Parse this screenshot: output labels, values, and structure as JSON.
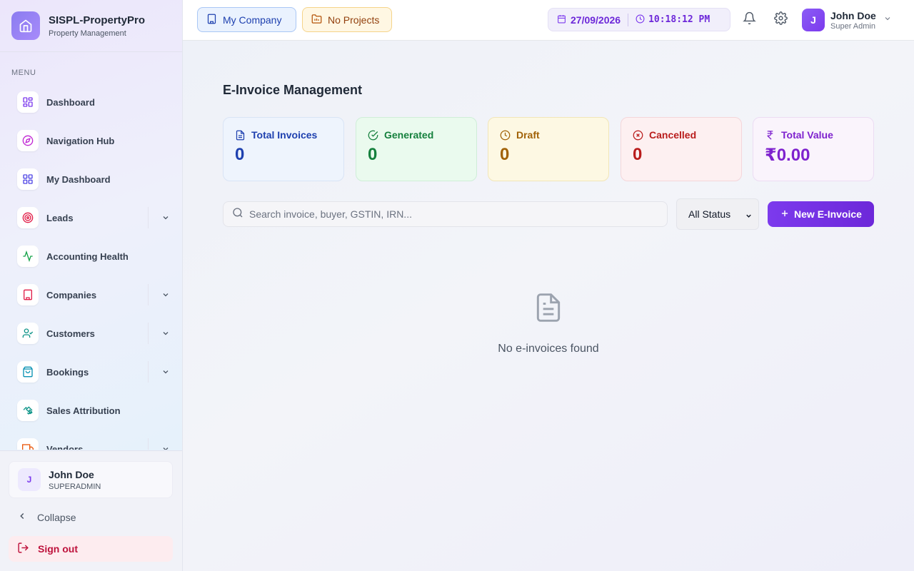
{
  "brand": {
    "name": "SISPL-PropertyPro",
    "subtitle": "Property Management",
    "icon": "home-icon"
  },
  "sidebar": {
    "menu_label": "MENU",
    "items": [
      {
        "label": "Dashboard",
        "icon": "grid-icon",
        "color": "#7c3aed",
        "expandable": false
      },
      {
        "label": "Navigation Hub",
        "icon": "compass-icon",
        "color": "#c026d3",
        "expandable": false
      },
      {
        "label": "My Dashboard",
        "icon": "grid-icon",
        "color": "#4f46e5",
        "expandable": false
      },
      {
        "label": "Leads",
        "icon": "target-icon",
        "color": "#e11d48",
        "expandable": true
      },
      {
        "label": "Accounting Health",
        "icon": "activity-icon",
        "color": "#16a34a",
        "expandable": false
      },
      {
        "label": "Companies",
        "icon": "building-icon",
        "color": "#e11d48",
        "expandable": true
      },
      {
        "label": "Customers",
        "icon": "user-check-icon",
        "color": "#0d9488",
        "expandable": true
      },
      {
        "label": "Bookings",
        "icon": "shopping-bag-icon",
        "color": "#0891b2",
        "expandable": true
      },
      {
        "label": "Sales Attribution",
        "icon": "handshake-icon",
        "color": "#0d9488",
        "expandable": false
      },
      {
        "label": "Vendors",
        "icon": "truck-icon",
        "color": "#ea580c",
        "expandable": true
      }
    ],
    "user": {
      "initial": "J",
      "name": "John Doe",
      "role": "SUPERADMIN"
    },
    "collapse_label": "Collapse",
    "signout_label": "Sign out"
  },
  "topbar": {
    "company_label": "My Company",
    "projects_label": "No Projects",
    "date": "27/09/2026",
    "time": "10:18:12 PM",
    "user": {
      "initial": "J",
      "name": "John Doe",
      "role": "Super Admin"
    }
  },
  "main": {
    "title": "E-Invoice Management",
    "stats": [
      {
        "label": "Total Invoices",
        "value": "0",
        "icon": "file-text-icon"
      },
      {
        "label": "Generated",
        "value": "0",
        "icon": "check-circle-icon"
      },
      {
        "label": "Draft",
        "value": "0",
        "icon": "clock-icon"
      },
      {
        "label": "Cancelled",
        "value": "0",
        "icon": "x-circle-icon"
      },
      {
        "label": "Total Value",
        "value": "₹0.00",
        "icon": "rupee-icon"
      }
    ],
    "search_placeholder": "Search invoice, buyer, GSTIN, IRN...",
    "status_filter": "All Status",
    "new_button": "New E-Invoice",
    "empty_message": "No e-invoices found"
  },
  "colors": {
    "accent": "#7c3aed",
    "danger": "#be123c"
  }
}
